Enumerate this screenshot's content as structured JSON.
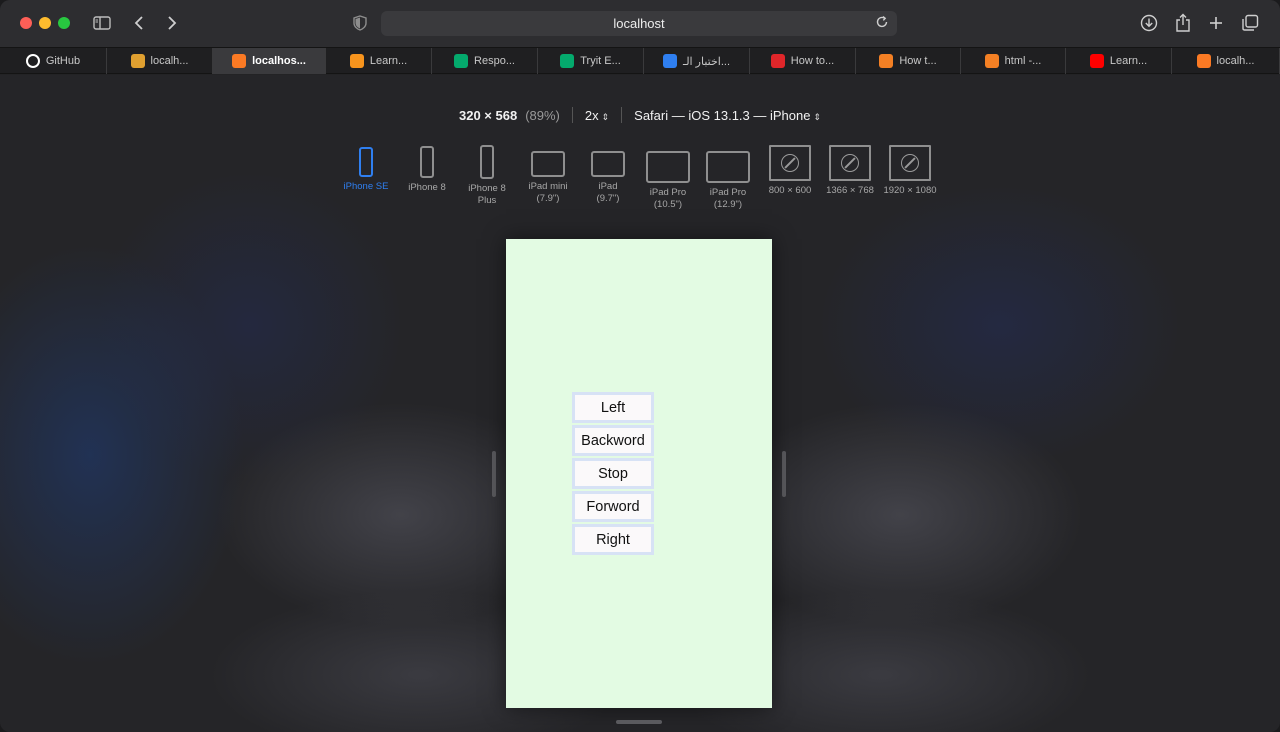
{
  "browser": {
    "url": "localhost",
    "tabs": [
      {
        "label": "GitHub",
        "favicon": "github-icon",
        "color": "#ffffff"
      },
      {
        "label": "localh...",
        "favicon": "xampp-icon",
        "color": "#e0a030"
      },
      {
        "label": "localhos...",
        "favicon": "xampp-icon",
        "color": "#fb7a24",
        "active": true
      },
      {
        "label": "Learn...",
        "favicon": "orange-square-icon",
        "color": "#f7941d"
      },
      {
        "label": "Respo...",
        "favicon": "w-icon",
        "color": "#04aa6d"
      },
      {
        "label": "Tryit E...",
        "favicon": "w-icon",
        "color": "#04aa6d"
      },
      {
        "label": "اختبار الـ...",
        "favicon": "store-icon",
        "color": "#2f7ff0"
      },
      {
        "label": "How to...",
        "favicon": "bh-icon",
        "color": "#e0262a"
      },
      {
        "label": "How t...",
        "favicon": "stackoverflow-icon",
        "color": "#f48024"
      },
      {
        "label": "html -...",
        "favicon": "stackoverflow-icon",
        "color": "#f48024"
      },
      {
        "label": "Learn...",
        "favicon": "youtube-icon",
        "color": "#ff0000"
      },
      {
        "label": "localh...",
        "favicon": "xampp-icon",
        "color": "#fb7a24"
      }
    ]
  },
  "responsive_toolbar": {
    "dimensions": "320 × 568",
    "zoom": "(89%)",
    "scale": "2x",
    "user_agent": "Safari — iOS 13.1.3 — iPhone"
  },
  "devices": [
    {
      "line1": "iPhone SE",
      "line2": "",
      "kind": "phone",
      "selected": true
    },
    {
      "line1": "iPhone 8",
      "line2": "",
      "kind": "phone"
    },
    {
      "line1": "iPhone 8",
      "line2": "Plus",
      "kind": "phone"
    },
    {
      "line1": "iPad mini",
      "line2": "(7.9\")",
      "kind": "tablet-s"
    },
    {
      "line1": "iPad",
      "line2": "(9.7\")",
      "kind": "tablet-s"
    },
    {
      "line1": "iPad Pro",
      "line2": "(10.5\")",
      "kind": "tablet-l"
    },
    {
      "line1": "iPad Pro",
      "line2": "(12.9\")",
      "kind": "tablet-l"
    },
    {
      "line1": "800 × 600",
      "line2": "",
      "kind": "desk"
    },
    {
      "line1": "1366 × 768",
      "line2": "",
      "kind": "desk"
    },
    {
      "line1": "1920 × 1080",
      "line2": "",
      "kind": "desk"
    }
  ],
  "page": {
    "background": "#e3fbe3",
    "buttons": [
      "Left",
      "Backword",
      "Stop",
      "Forword",
      "Right"
    ]
  }
}
